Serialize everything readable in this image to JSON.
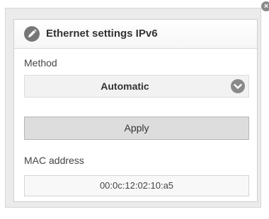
{
  "panel": {
    "title": "Ethernet settings IPv6",
    "title_icon": "edit-icon",
    "close_icon": "close-icon"
  },
  "method": {
    "label": "Method",
    "selected": "Automatic",
    "dropdown_icon": "chevron-down-icon"
  },
  "apply": {
    "label": "Apply"
  },
  "mac": {
    "label": "MAC address",
    "value": "00:0c:12:02:10:a5"
  }
}
